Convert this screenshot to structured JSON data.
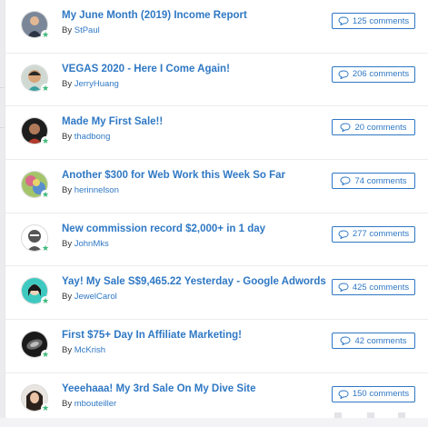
{
  "by_label": "By",
  "colors": {
    "link": "#2f78c4",
    "badge": "#3cb878"
  },
  "topics": [
    {
      "title": "My June Month (2019) Income Report",
      "author": "StPaul",
      "comments": "125 comments"
    },
    {
      "title": "VEGAS 2020 - Here I Come Again!",
      "author": "JerryHuang",
      "comments": "206 comments"
    },
    {
      "title": "Made My First Sale!!",
      "author": "thadbong",
      "comments": "20 comments"
    },
    {
      "title": "Another $300 for Web Work this Week So Far",
      "author": "herinnelson",
      "comments": "74 comments"
    },
    {
      "title": "New commission record $2,000+ in 1 day",
      "author": "JohnMks",
      "comments": "277 comments"
    },
    {
      "title": "Yay! My Sale S$9,465.22 Yesterday - Google Adwords",
      "author": "JewelCarol",
      "comments": "425 comments"
    },
    {
      "title": "First $75+ Day In Affiliate Marketing!",
      "author": "McKrish",
      "comments": "42 comments"
    },
    {
      "title": "Yeeehaaa! My 3rd Sale On My Dive Site",
      "author": "mbouteiller",
      "comments": "150 comments"
    }
  ]
}
